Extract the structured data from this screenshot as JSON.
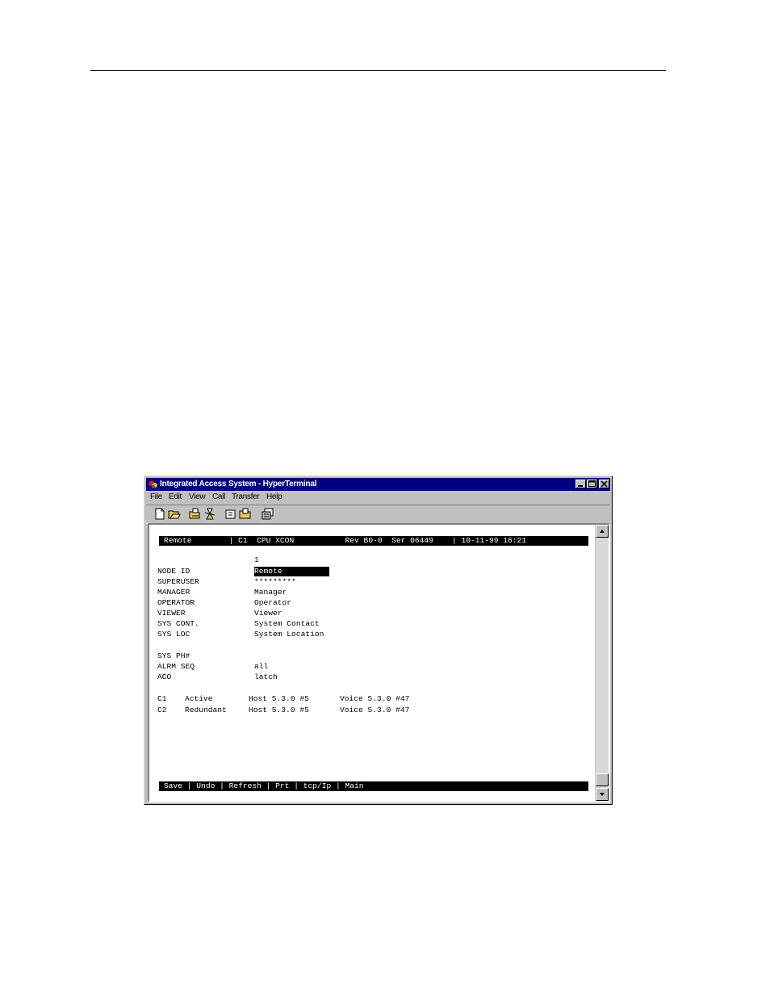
{
  "window": {
    "title": "Integrated Access System - HyperTerminal"
  },
  "menu": {
    "items": [
      "File",
      "Edit",
      "View",
      "Call",
      "Transfer",
      "Help"
    ]
  },
  "toolbar": {
    "icons": [
      "new-file-icon",
      "open-file-icon",
      "connect-icon",
      "disconnect-icon",
      "send-icon",
      "receive-icon",
      "properties-icon"
    ]
  },
  "terminal": {
    "header": "Remote        | C1  CPU XCON           Rev B0-0  Ser 06449    | 10-11-99 16:21",
    "column_number": "1",
    "fields": [
      {
        "label": "NODE ID",
        "value": "Remote"
      },
      {
        "label": "SUPERUSER",
        "value": "*********"
      },
      {
        "label": "MANAGER",
        "value": "Manager"
      },
      {
        "label": "OPERATOR",
        "value": "Operator"
      },
      {
        "label": "VIEWER",
        "value": "Viewer"
      },
      {
        "label": "SYS CONT.",
        "value": "System Contact"
      },
      {
        "label": "SYS LOC",
        "value": "System Location"
      },
      {
        "label": "SYS PH#",
        "value": ""
      },
      {
        "label": "ALRM SEQ",
        "value": "all"
      },
      {
        "label": "ACO",
        "value": "latch"
      }
    ],
    "cards": [
      {
        "slot": "C1",
        "state": "Active",
        "host": "Host 5.3.0 #5",
        "voice": "Voice 5.3.0 #47"
      },
      {
        "slot": "C2",
        "state": "Redundant",
        "host": "Host 5.3.0 #5",
        "voice": "Voice 5.3.0 #47"
      }
    ],
    "commands": "Save | Undo | Refresh | Prt | tcp/Ip | Main"
  }
}
